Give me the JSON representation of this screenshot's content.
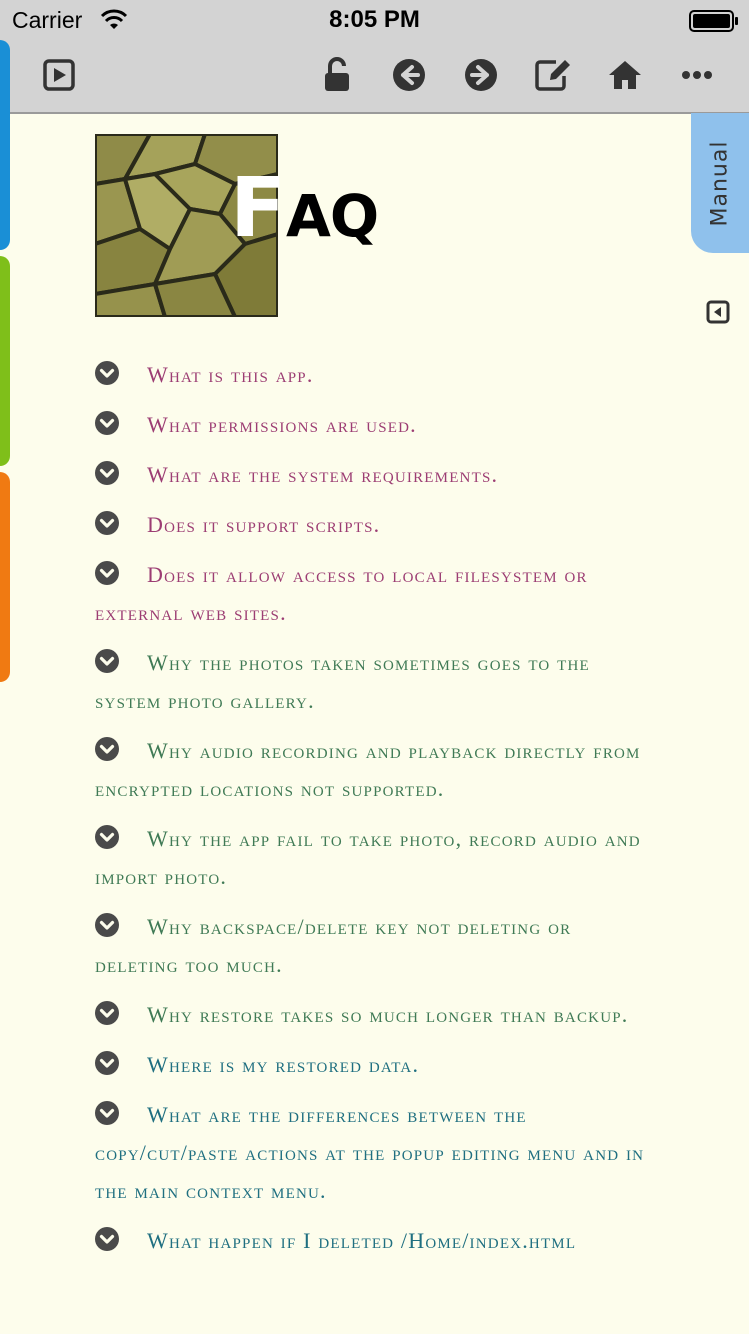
{
  "status_bar": {
    "carrier": "Carrier",
    "time": "8:05 PM"
  },
  "toolbar": {
    "icons": [
      "play-square-icon",
      "unlock-icon",
      "back-arrow-icon",
      "forward-arrow-icon",
      "edit-icon",
      "home-icon",
      "more-icon"
    ]
  },
  "side_tabs": {
    "colors": [
      "#1a8fd6",
      "#7fbf1a",
      "#f07a12"
    ]
  },
  "manual_tab": {
    "label": "Manual",
    "color": "#8fc1ec"
  },
  "heading": {
    "first_letter": "F",
    "rest": "AQ"
  },
  "colors": {
    "question_purple": "#9c3d73",
    "question_green": "#3f7a55",
    "background": "#fdfdec"
  },
  "faq": {
    "items": [
      {
        "text": "What is this app.",
        "color": "#9c3d73"
      },
      {
        "text": "What permissions are used.",
        "color": "#9c3d73"
      },
      {
        "text": "What are the system requirements.",
        "color": "#9c3d73"
      },
      {
        "text": "Does it support scripts.",
        "color": "#9c3d73"
      },
      {
        "text": "Does it allow access to local filesystem or external web sites.",
        "color": "#9c3d73"
      },
      {
        "text": "Why the photos taken sometimes goes to the system photo gallery.",
        "color": "#3f7a55"
      },
      {
        "text": "Why audio recording and playback directly from encrypted locations not supported.",
        "color": "#3f7a55"
      },
      {
        "text": "Why the app fail to take photo, record audio and import photo.",
        "color": "#3f7a55"
      },
      {
        "text": "Why backspace/delete key not deleting or deleting too much.",
        "color": "#3f7a55"
      },
      {
        "text": "Why restore takes so much longer than backup.",
        "color": "#3f7a55"
      },
      {
        "text": "Where is my restored data.",
        "color": "#1f6f80"
      },
      {
        "text": "What are the differences between the copy/cut/paste actions at the popup editing menu and in the main context menu.",
        "color": "#1f6f80"
      },
      {
        "text": "What happen if I deleted /Home/index.html",
        "color": "#1f6f80"
      }
    ]
  }
}
